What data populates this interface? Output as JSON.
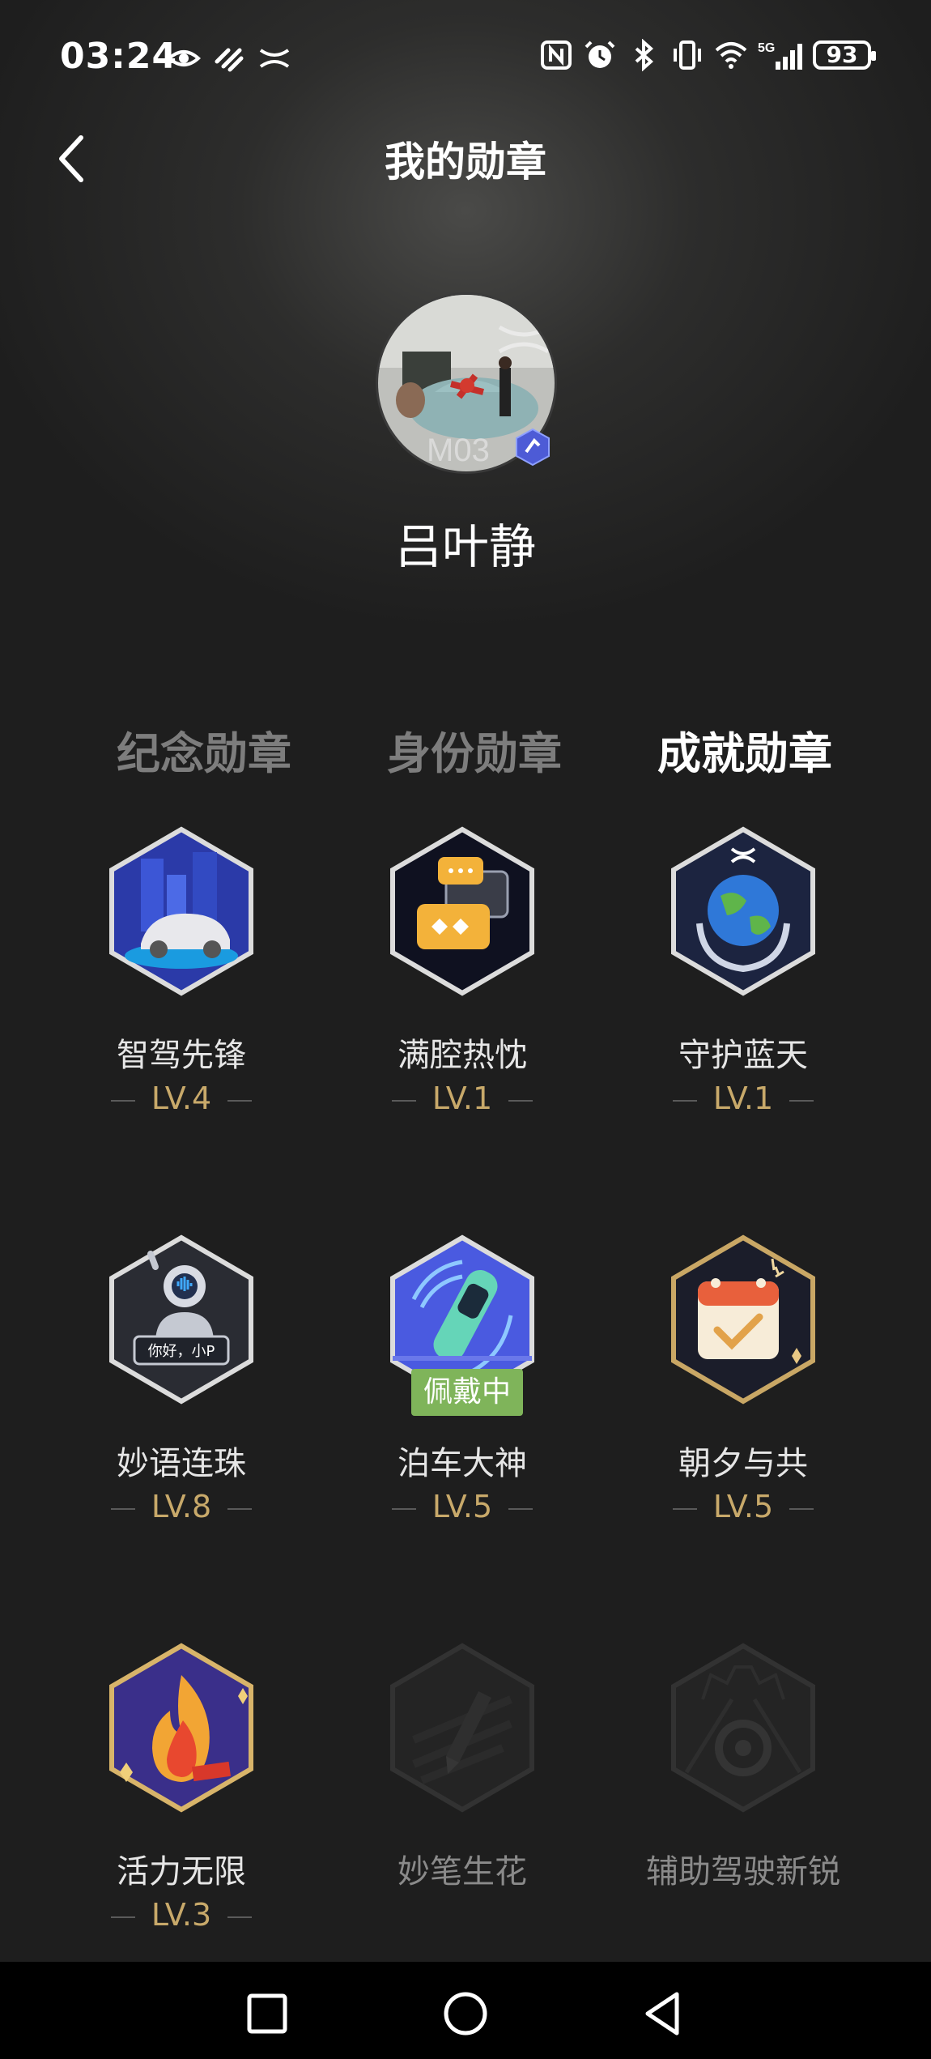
{
  "status_bar": {
    "time": "03:24",
    "battery": "93",
    "network": "5G",
    "left_icons": [
      "eye-icon",
      "signal-app-icon",
      "brand-icon"
    ],
    "right_icons": [
      "nfc-icon",
      "alarm-icon",
      "bluetooth-icon",
      "vibrate-icon",
      "wifi-icon",
      "cell-signal-icon",
      "battery-icon"
    ]
  },
  "header": {
    "title": "我的勋章",
    "back_icon": "chevron-left-icon"
  },
  "profile": {
    "username": "吕叶静"
  },
  "tabs": [
    {
      "label": "纪念勋章",
      "active": false
    },
    {
      "label": "身份勋章",
      "active": false
    },
    {
      "label": "成就勋章",
      "active": true
    }
  ],
  "badges": [
    {
      "name": "智驾先锋",
      "level": "LV.4",
      "icon": "smart-driving-car-icon",
      "locked": false
    },
    {
      "name": "满腔热忱",
      "level": "LV.1",
      "icon": "chat-bubbles-icon",
      "locked": false
    },
    {
      "name": "守护蓝天",
      "level": "LV.1",
      "icon": "earth-hands-icon",
      "locked": false
    },
    {
      "name": "妙语连珠",
      "level": "LV.8",
      "icon": "voice-assistant-icon",
      "locked": false,
      "bubble": "你好，小P"
    },
    {
      "name": "泊车大神",
      "level": "LV.5",
      "icon": "parking-car-icon",
      "locked": false,
      "status": "佩戴中"
    },
    {
      "name": "朝夕与共",
      "level": "LV.5",
      "icon": "calendar-check-icon",
      "locked": false
    },
    {
      "name": "活力无限",
      "level": "LV.3",
      "icon": "flame-icon",
      "locked": false
    },
    {
      "name": "妙笔生花",
      "level": "",
      "icon": "pen-icon",
      "locked": true
    },
    {
      "name": "辅助驾驶新锐",
      "level": "",
      "icon": "steering-road-icon",
      "locked": true
    }
  ],
  "colors": {
    "background": "#1e1e1e",
    "level_gold": "#c8a96a",
    "wearing_green": "#7fb45a",
    "tab_inactive": "#7d7d7d"
  },
  "navbar": {
    "buttons": [
      "recent-apps-icon",
      "home-icon",
      "back-icon"
    ]
  }
}
